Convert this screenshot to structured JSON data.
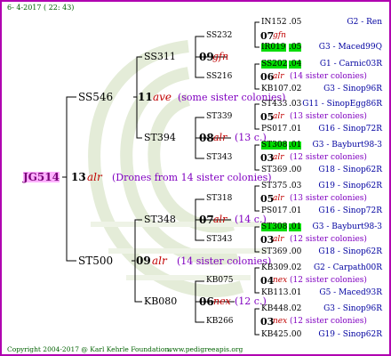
{
  "header": {
    "date": "6- 4-2017 ( 22: 43)"
  },
  "footer": {
    "copyright": "Copyright 2004-2017 @ Karl Kehrle Foundation.",
    "site": "www.pedigreeapis.org"
  },
  "root": {
    "id": "JG514",
    "num": "13",
    "race": "alr",
    "note": "(Drones from 14 sister colonies)"
  },
  "gen1": [
    {
      "id": "SS546",
      "num": "11",
      "race": "ave",
      "note": "(some sister colonies)"
    },
    {
      "id": "ST500",
      "num": "09",
      "race": "alr",
      "note": "(14 sister colonies)"
    }
  ],
  "gen2": [
    {
      "id": "SS311",
      "num": "09",
      "race": "gfn",
      "note": ""
    },
    {
      "id": "ST394",
      "num": "08",
      "race": "alr",
      "note": "(13 c.)"
    },
    {
      "id": "ST348",
      "num": "07",
      "race": "alr",
      "note": "(14 c.)"
    },
    {
      "id": "KB080",
      "num": "06",
      "race": "nex",
      "note": "(12 c.)"
    }
  ],
  "gen3": [
    {
      "id": "SS232",
      "num": "07",
      "race": "gfn",
      "note": ""
    },
    {
      "id": "SS216",
      "num": "06",
      "race": "alr",
      "note": "(14 sister colonies)"
    },
    {
      "id": "ST339",
      "num": "05",
      "race": "alr",
      "note": "(13 sister colonies)"
    },
    {
      "id": "ST343",
      "num": "03",
      "race": "alr",
      "note": "(12 sister colonies)"
    },
    {
      "id": "ST318",
      "num": "05",
      "race": "alr",
      "note": "(13 sister colonies)"
    },
    {
      "id": "ST343",
      "num": "03",
      "race": "alr",
      "note": "(12 sister colonies)"
    },
    {
      "id": "KB075",
      "num": "04",
      "race": "nex",
      "note": "(12 sister colonies)"
    },
    {
      "id": "KB266",
      "num": "03",
      "race": "nex",
      "note": "(12 sister colonies)"
    }
  ],
  "gen4": [
    {
      "id": "IN152",
      "year": ".05",
      "loc": "G2 - Ren",
      "hl": false
    },
    {
      "id": "IR019",
      "year": ".05",
      "loc": "G3 - Maced99Q",
      "hl": true
    },
    {
      "id": "SS202",
      "year": ".04",
      "loc": "G1 - Carnic03R",
      "hl": true
    },
    {
      "id": "KB107",
      "year": ".02",
      "loc": "G3 - Sinop96R",
      "hl": false
    },
    {
      "id": "ST433",
      "year": ".03",
      "loc": "G11 - SinopEgg86R",
      "hl": false
    },
    {
      "id": "PS017",
      "year": ".01",
      "loc": "G16 - Sinop72R",
      "hl": false
    },
    {
      "id": "ST308",
      "year": ".01",
      "loc": "G3 - Bayburt98-3",
      "hl": true
    },
    {
      "id": "ST369",
      "year": ".00",
      "loc": "G18 - Sinop62R",
      "hl": false
    },
    {
      "id": "ST375",
      "year": ".03",
      "loc": "G19 - Sinop62R",
      "hl": false
    },
    {
      "id": "PS017",
      "year": ".01",
      "loc": "G16 - Sinop72R",
      "hl": false
    },
    {
      "id": "ST308",
      "year": ".01",
      "loc": "G3 - Bayburt98-3",
      "hl": true
    },
    {
      "id": "ST369",
      "year": ".00",
      "loc": "G18 - Sinop62R",
      "hl": false
    },
    {
      "id": "KB309",
      "year": ".02",
      "loc": "G2 - Carpath00R",
      "hl": false
    },
    {
      "id": "KB113",
      "year": ".01",
      "loc": "G5 - Maced93R",
      "hl": false
    },
    {
      "id": "KB448",
      "year": ".02",
      "loc": "G3 - Sinop96R",
      "hl": false
    },
    {
      "id": "KB425",
      "year": ".00",
      "loc": "G19 - Sinop62R",
      "hl": false
    }
  ]
}
